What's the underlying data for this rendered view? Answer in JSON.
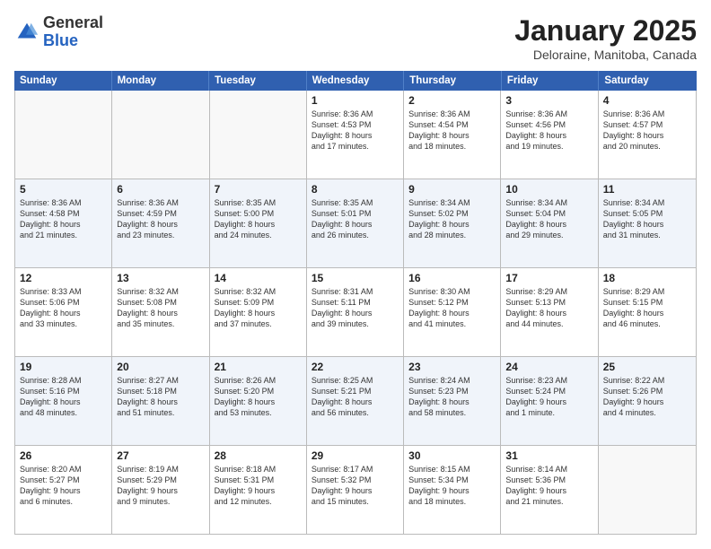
{
  "header": {
    "logo_general": "General",
    "logo_blue": "Blue",
    "title": "January 2025",
    "subtitle": "Deloraine, Manitoba, Canada"
  },
  "days_of_week": [
    "Sunday",
    "Monday",
    "Tuesday",
    "Wednesday",
    "Thursday",
    "Friday",
    "Saturday"
  ],
  "weeks": [
    [
      {
        "day": "",
        "text": ""
      },
      {
        "day": "",
        "text": ""
      },
      {
        "day": "",
        "text": ""
      },
      {
        "day": "1",
        "text": "Sunrise: 8:36 AM\nSunset: 4:53 PM\nDaylight: 8 hours\nand 17 minutes."
      },
      {
        "day": "2",
        "text": "Sunrise: 8:36 AM\nSunset: 4:54 PM\nDaylight: 8 hours\nand 18 minutes."
      },
      {
        "day": "3",
        "text": "Sunrise: 8:36 AM\nSunset: 4:56 PM\nDaylight: 8 hours\nand 19 minutes."
      },
      {
        "day": "4",
        "text": "Sunrise: 8:36 AM\nSunset: 4:57 PM\nDaylight: 8 hours\nand 20 minutes."
      }
    ],
    [
      {
        "day": "5",
        "text": "Sunrise: 8:36 AM\nSunset: 4:58 PM\nDaylight: 8 hours\nand 21 minutes."
      },
      {
        "day": "6",
        "text": "Sunrise: 8:36 AM\nSunset: 4:59 PM\nDaylight: 8 hours\nand 23 minutes."
      },
      {
        "day": "7",
        "text": "Sunrise: 8:35 AM\nSunset: 5:00 PM\nDaylight: 8 hours\nand 24 minutes."
      },
      {
        "day": "8",
        "text": "Sunrise: 8:35 AM\nSunset: 5:01 PM\nDaylight: 8 hours\nand 26 minutes."
      },
      {
        "day": "9",
        "text": "Sunrise: 8:34 AM\nSunset: 5:02 PM\nDaylight: 8 hours\nand 28 minutes."
      },
      {
        "day": "10",
        "text": "Sunrise: 8:34 AM\nSunset: 5:04 PM\nDaylight: 8 hours\nand 29 minutes."
      },
      {
        "day": "11",
        "text": "Sunrise: 8:34 AM\nSunset: 5:05 PM\nDaylight: 8 hours\nand 31 minutes."
      }
    ],
    [
      {
        "day": "12",
        "text": "Sunrise: 8:33 AM\nSunset: 5:06 PM\nDaylight: 8 hours\nand 33 minutes."
      },
      {
        "day": "13",
        "text": "Sunrise: 8:32 AM\nSunset: 5:08 PM\nDaylight: 8 hours\nand 35 minutes."
      },
      {
        "day": "14",
        "text": "Sunrise: 8:32 AM\nSunset: 5:09 PM\nDaylight: 8 hours\nand 37 minutes."
      },
      {
        "day": "15",
        "text": "Sunrise: 8:31 AM\nSunset: 5:11 PM\nDaylight: 8 hours\nand 39 minutes."
      },
      {
        "day": "16",
        "text": "Sunrise: 8:30 AM\nSunset: 5:12 PM\nDaylight: 8 hours\nand 41 minutes."
      },
      {
        "day": "17",
        "text": "Sunrise: 8:29 AM\nSunset: 5:13 PM\nDaylight: 8 hours\nand 44 minutes."
      },
      {
        "day": "18",
        "text": "Sunrise: 8:29 AM\nSunset: 5:15 PM\nDaylight: 8 hours\nand 46 minutes."
      }
    ],
    [
      {
        "day": "19",
        "text": "Sunrise: 8:28 AM\nSunset: 5:16 PM\nDaylight: 8 hours\nand 48 minutes."
      },
      {
        "day": "20",
        "text": "Sunrise: 8:27 AM\nSunset: 5:18 PM\nDaylight: 8 hours\nand 51 minutes."
      },
      {
        "day": "21",
        "text": "Sunrise: 8:26 AM\nSunset: 5:20 PM\nDaylight: 8 hours\nand 53 minutes."
      },
      {
        "day": "22",
        "text": "Sunrise: 8:25 AM\nSunset: 5:21 PM\nDaylight: 8 hours\nand 56 minutes."
      },
      {
        "day": "23",
        "text": "Sunrise: 8:24 AM\nSunset: 5:23 PM\nDaylight: 8 hours\nand 58 minutes."
      },
      {
        "day": "24",
        "text": "Sunrise: 8:23 AM\nSunset: 5:24 PM\nDaylight: 9 hours\nand 1 minute."
      },
      {
        "day": "25",
        "text": "Sunrise: 8:22 AM\nSunset: 5:26 PM\nDaylight: 9 hours\nand 4 minutes."
      }
    ],
    [
      {
        "day": "26",
        "text": "Sunrise: 8:20 AM\nSunset: 5:27 PM\nDaylight: 9 hours\nand 6 minutes."
      },
      {
        "day": "27",
        "text": "Sunrise: 8:19 AM\nSunset: 5:29 PM\nDaylight: 9 hours\nand 9 minutes."
      },
      {
        "day": "28",
        "text": "Sunrise: 8:18 AM\nSunset: 5:31 PM\nDaylight: 9 hours\nand 12 minutes."
      },
      {
        "day": "29",
        "text": "Sunrise: 8:17 AM\nSunset: 5:32 PM\nDaylight: 9 hours\nand 15 minutes."
      },
      {
        "day": "30",
        "text": "Sunrise: 8:15 AM\nSunset: 5:34 PM\nDaylight: 9 hours\nand 18 minutes."
      },
      {
        "day": "31",
        "text": "Sunrise: 8:14 AM\nSunset: 5:36 PM\nDaylight: 9 hours\nand 21 minutes."
      },
      {
        "day": "",
        "text": ""
      }
    ]
  ]
}
